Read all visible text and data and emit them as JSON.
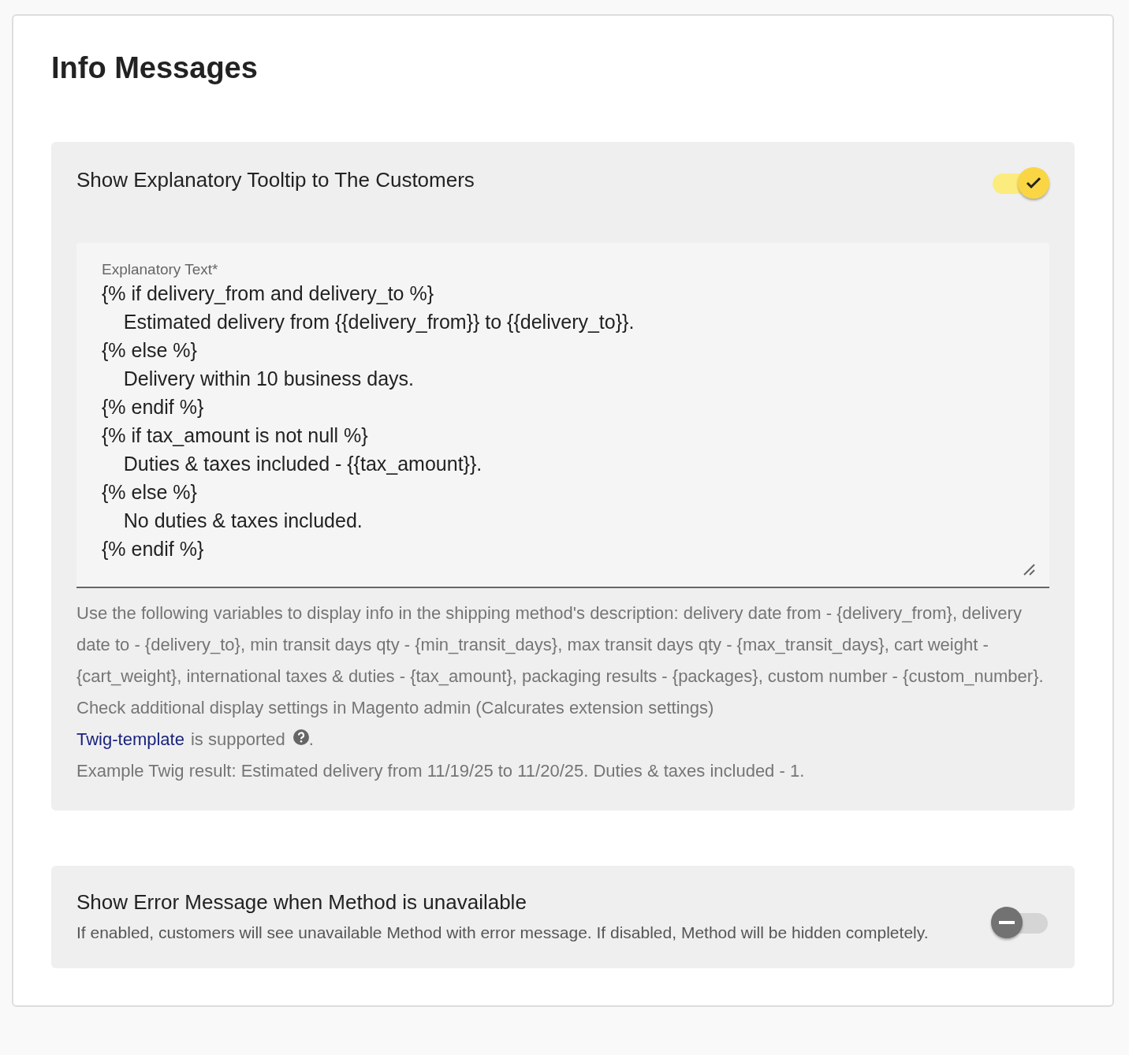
{
  "title": "Info Messages",
  "sections": [
    {
      "kind": "tooltip",
      "title": "Show Explanatory Tooltip to The Customers",
      "on": true,
      "field": {
        "label": "Explanatory Text*",
        "value": "{% if delivery_from and delivery_to %}\n    Estimated delivery from {{delivery_from}} to {{delivery_to}}.\n{% else %}\n    Delivery within 10 business days.\n{% endif %}\n{% if tax_amount is not null %}\n    Duties & taxes included - {{tax_amount}}.\n{% else %}\n    No duties & taxes included.\n{% endif %}"
      },
      "help": "Use the following variables to display info in the shipping method's description: delivery date from - {delivery_from}, delivery date to - {delivery_to}, min transit days qty - {min_transit_days}, max transit days qty - {max_transit_days}, cart weight - {cart_weight}, international taxes & duties - {tax_amount}, packaging results - {packages}, custom number - {custom_number}. Check additional display settings in Magento admin (Calcurates extension settings)",
      "twig": {
        "link": "Twig-template",
        "text": "is supported",
        "suffix": "."
      },
      "example": "Example Twig result: Estimated delivery from 11/19/25 to 11/20/25. Duties & taxes included - 1."
    },
    {
      "kind": "error",
      "title": "Show Error Message when Method is unavailable",
      "on": false,
      "description": "If enabled, customers will see unavailable Method with error message. If disabled, Method will be hidden completely."
    }
  ]
}
